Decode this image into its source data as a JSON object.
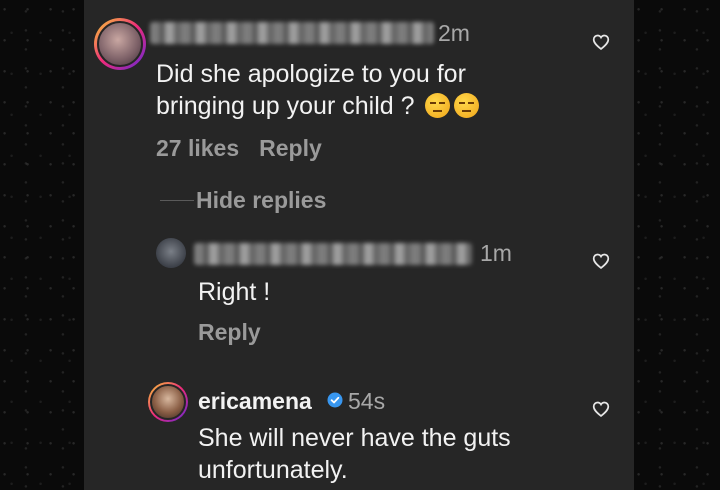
{
  "comments": [
    {
      "time": "2m",
      "text_lines": [
        "Did she apologize to you for",
        "bringing up your child ?"
      ],
      "emoji": [
        "unamused-face",
        "unamused-face"
      ],
      "likes": "27 likes",
      "reply": "Reply",
      "hide_replies": "Hide replies"
    },
    {
      "time": "1m",
      "text_lines": [
        "Right !"
      ],
      "reply": "Reply"
    },
    {
      "username": "ericamena",
      "verified": true,
      "time": "54s",
      "text_lines": [
        "She will never have the guts",
        "unfortunately."
      ]
    }
  ],
  "colors": {
    "panel_bg": "#262626",
    "text": "#f2f2f2",
    "muted": "#9a9a9a",
    "verified": "#3897f0"
  }
}
